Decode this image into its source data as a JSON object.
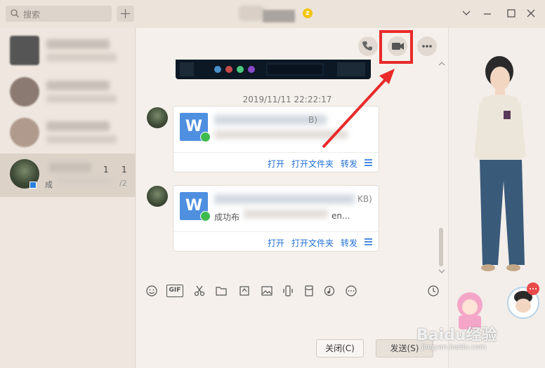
{
  "search": {
    "placeholder": "搜索"
  },
  "title": {
    "badge": "z"
  },
  "contacts": [
    {
      "name_suffix": ""
    },
    {
      "name_suffix": ""
    },
    {
      "name_suffix": ""
    },
    {
      "selected": true,
      "meta_a": "1",
      "meta_b": "1",
      "preview_prefix": "成",
      "preview_tail": "/2"
    }
  ],
  "chat": {
    "timestamp": "2019/11/11 22:22:17",
    "messages": [
      {
        "file_icon": "W",
        "size_tail": "B)",
        "actions": [
          "打开",
          "打开文件夹",
          "转发"
        ]
      },
      {
        "file_icon": "W",
        "size_tail": "KB)",
        "status_prefix": "成功布",
        "status_tail": "en...",
        "actions": [
          "打开",
          "打开文件夹",
          "转发"
        ]
      }
    ]
  },
  "toolbar": {
    "gif_label": "GIF",
    "close_label": "关闭(C)",
    "send_label": "发送(S)"
  },
  "watermark": {
    "text": "Baidu经验",
    "sub": "jingyan.baidu.com"
  },
  "colors": {
    "highlight": "#e82a2a",
    "accent": "#1f6fd8",
    "check": "#3dbb4f"
  }
}
